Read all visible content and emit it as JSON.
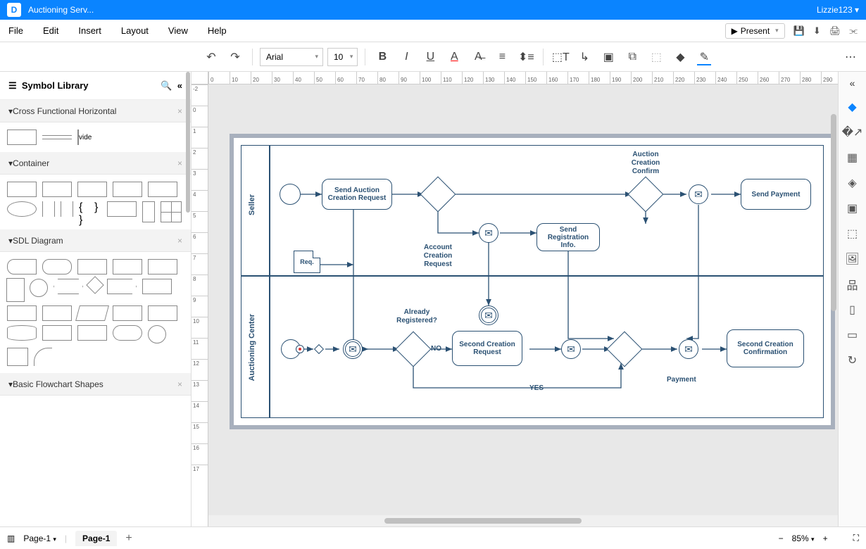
{
  "titlebar": {
    "app_title": "Auctioning Serv...",
    "user": "Lizzie123"
  },
  "menu": {
    "file": "File",
    "edit": "Edit",
    "insert": "Insert",
    "layout": "Layout",
    "view": "View",
    "help": "Help",
    "present": "Present"
  },
  "toolbar": {
    "font": "Arial",
    "size": "10"
  },
  "sidebar": {
    "title": "Symbol Library",
    "sections": {
      "cross": "Cross Functional Horizontal",
      "container": "Container",
      "sdl": "SDL Diagram",
      "basic": "Basic Flowchart Shapes"
    },
    "vide": "vide"
  },
  "diagram": {
    "lanes": {
      "seller": "Seller",
      "center": "Auctioning Center"
    },
    "nodes": {
      "send_auction": "Send Auction Creation Request",
      "send_reg": "Send Registration Info.",
      "send_payment": "Send Payment",
      "second_req": "Second Creation Request",
      "second_conf": "Second Creation Confirmation",
      "req_doc": "Req."
    },
    "labels": {
      "auction_confirm": "Auction Creation Confirm",
      "account_req": "Account Creation Request",
      "already_reg": "Already Registered?",
      "no": "NO",
      "yes": "YES",
      "payment": "Payment"
    }
  },
  "pages": {
    "dropdown": "Page-1",
    "tab": "Page-1"
  },
  "zoom": "85%"
}
